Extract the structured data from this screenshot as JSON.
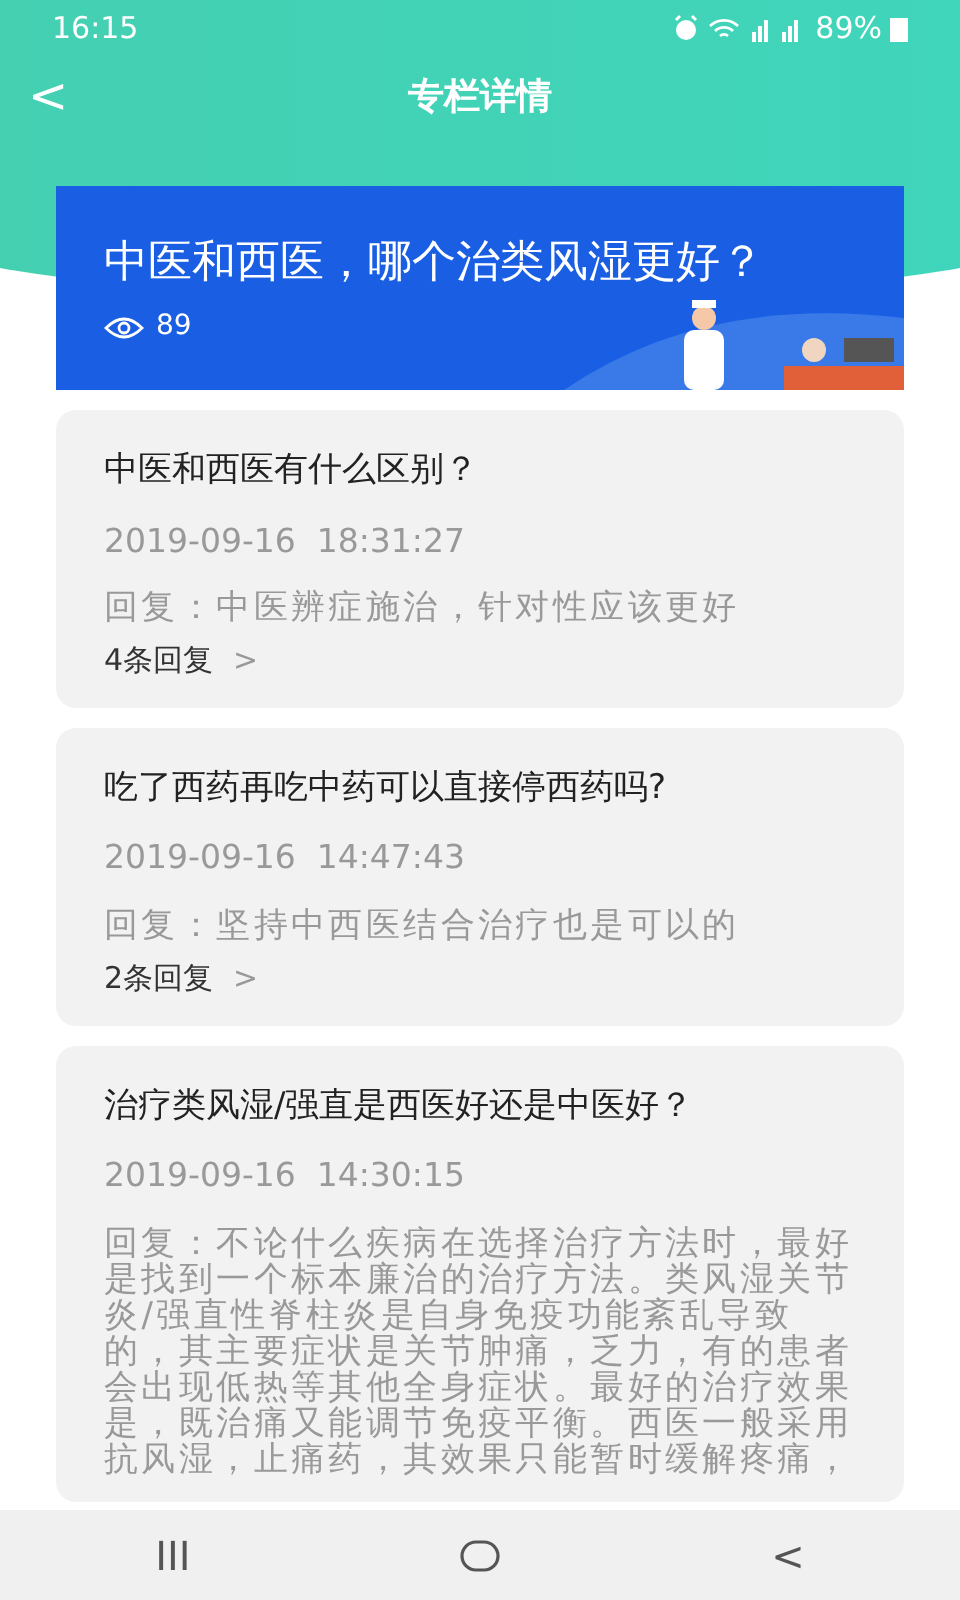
{
  "status_bar": {
    "time": "16:15",
    "battery": "89%"
  },
  "header": {
    "back": "<",
    "title": "专栏详情"
  },
  "banner": {
    "title": "中医和西医，哪个治类风湿更好？",
    "views": "89"
  },
  "posts": [
    {
      "question": "中医和西医有什么区别？",
      "date": "2019-09-16  18:31:27",
      "reply": "回复：中医辨症施治，针对性应该更好",
      "count": "4条回复",
      "arrow": ">"
    },
    {
      "question": "吃了西药再吃中药可以直接停西药吗?",
      "date": "2019-09-16  14:47:43",
      "reply": "回复：坚持中西医结合治疗也是可以的",
      "count": "2条回复",
      "arrow": ">"
    },
    {
      "question": "治疗类风湿/强直是西医好还是中医好？",
      "date": "2019-09-16  14:30:15",
      "reply": "回复：不论什么疾病在选择治疗方法时，最好是找到一个标本廉治的治疗方法。类风湿关节炎/强直性脊柱炎是自身免疫功能紊乱导致的，其主要症状是关节肿痛，乏力，有的患者会出现低热等其他全身症状。最好的治疗效果是，既治痛又能调节免疫平衡。西医一般采用抗风湿，止痛药，其效果只能暂时缓解疼痛，"
    }
  ],
  "nav_bar": {
    "recent": "III",
    "back": "<"
  }
}
